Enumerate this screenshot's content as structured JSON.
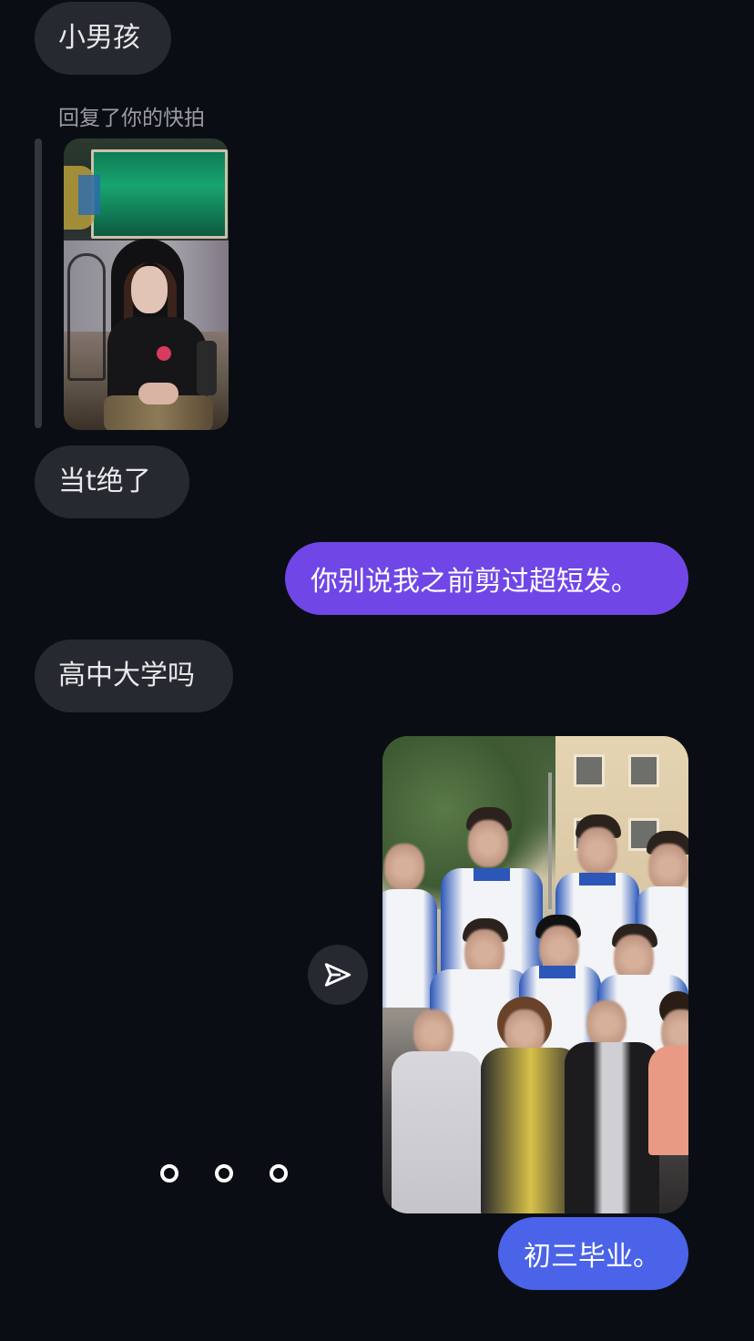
{
  "messages": {
    "m1": "小男孩",
    "reply_label": "回复了你的快拍",
    "m2": "当t绝了",
    "m3": "你别说我之前剪过超短发。",
    "m4": "高中大学吗",
    "m5": "初三毕业。"
  },
  "colors": {
    "incoming_bubble": "#262a30",
    "outgoing_purple": "#7047e6",
    "outgoing_blue": "#4a63e8",
    "background": "#0a0e14"
  },
  "icons": {
    "share": "send-icon",
    "typing": "typing-indicator"
  }
}
